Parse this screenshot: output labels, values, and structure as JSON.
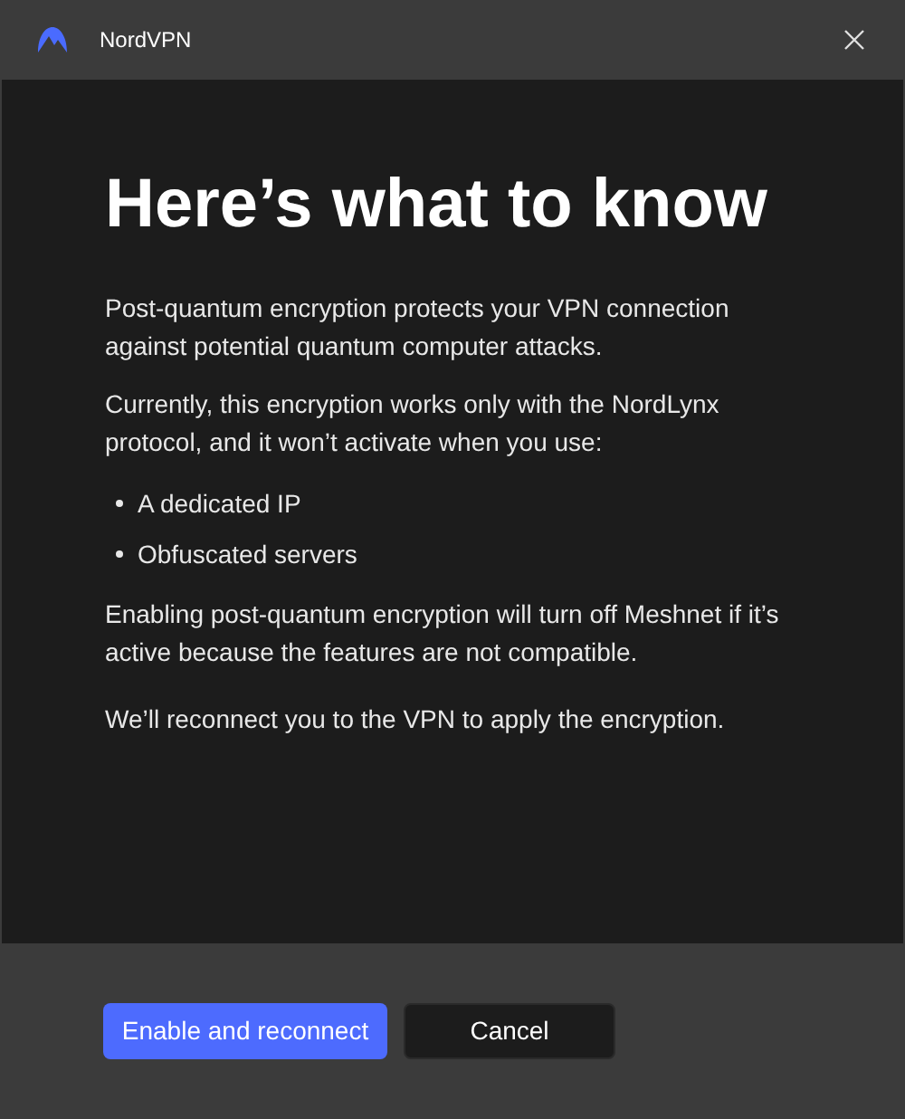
{
  "window": {
    "title": "NordVPN"
  },
  "heading": "Here’s what to know",
  "paragraphs_before": [
    "Post-quantum encryption protects your VPN connection against potential quantum computer attacks.",
    "Currently, this encryption works only with the NordLynx protocol, and it won’t activate when you use:"
  ],
  "bullets": [
    "A dedicated IP",
    "Obfuscated servers"
  ],
  "paragraphs_after": [
    "Enabling post-quantum encryption will turn off Meshnet if it’s active because the features are not compatible.",
    "We’ll reconnect you to the VPN to apply the encryption."
  ],
  "buttons": [
    {
      "label": "Enable and reconnect",
      "kind": "primary"
    },
    {
      "label": "Cancel",
      "kind": "secondary"
    }
  ]
}
